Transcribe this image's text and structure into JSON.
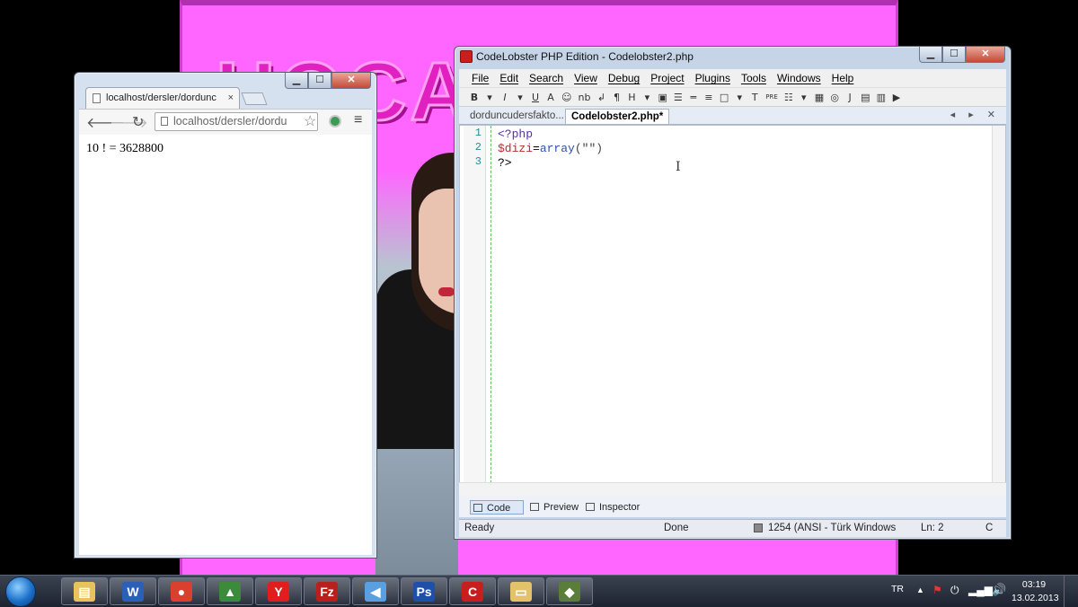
{
  "desktop": {
    "banner_text": "HOCA"
  },
  "browser": {
    "tab_title": "localhost/dersler/dordunc",
    "tab_close": "×",
    "address": "localhost/dersler/dordu",
    "page_output": "10 ! = 3628800"
  },
  "editor": {
    "window_title": "CodeLobster PHP Edition - Codelobster2.php",
    "menu": [
      "File",
      "Edit",
      "Search",
      "View",
      "Debug",
      "Project",
      "Plugins",
      "Tools",
      "Windows",
      "Help"
    ],
    "toolbar_glyphs": [
      "B",
      "▾",
      "I",
      "▾",
      "U",
      "A",
      "☺",
      "nb",
      "↲",
      "¶",
      "H",
      "▾",
      "▣",
      "☰",
      "═",
      "≡",
      "□",
      "▾",
      "T",
      "PRE",
      "☷",
      "▾",
      "▦",
      "◎",
      "J",
      "▤",
      "▥",
      "▶"
    ],
    "file_tabs": [
      "dorduncudersfakto...",
      "Codelobster2.php*"
    ],
    "tab_controls": "◂ ▸ ✕",
    "line_numbers": [
      "1",
      "2",
      "3"
    ],
    "code_lines": {
      "l1_tag": "<?php",
      "l2_var": "$dizi",
      "l2_eq": "=",
      "l2_fn": "array",
      "l2_args": "(\"\")",
      "l3_close": "?>"
    },
    "view_tabs": [
      "Code",
      "Preview",
      "Inspector"
    ],
    "status": {
      "left": "Ready",
      "mid": "Done",
      "encoding": "1254 (ANSI - Türk Windows",
      "line": "Ln: 2",
      "col": "C"
    }
  },
  "taskbar": {
    "apps": [
      {
        "name": "Windows Explorer",
        "glyph": "▤",
        "color": "#e8c25a"
      },
      {
        "name": "Word",
        "glyph": "W",
        "color": "#2b5fb8"
      },
      {
        "name": "Chrome",
        "glyph": "●",
        "color": "#d9412e"
      },
      {
        "name": "Image viewer",
        "glyph": "▲",
        "color": "#3b8b3b"
      },
      {
        "name": "Yandex",
        "glyph": "Y",
        "color": "#e11d1d"
      },
      {
        "name": "FileZilla",
        "glyph": "Fz",
        "color": "#b8201c"
      },
      {
        "name": "Media",
        "glyph": "◀",
        "color": "#5aa0e0"
      },
      {
        "name": "Photoshop",
        "glyph": "Ps",
        "color": "#1f4fa8"
      },
      {
        "name": "CodeLobster",
        "glyph": "C",
        "color": "#c81e1e"
      },
      {
        "name": "Folder",
        "glyph": "▭",
        "color": "#e2c36a"
      },
      {
        "name": "Tool",
        "glyph": "◆",
        "color": "#5b7d3a"
      }
    ],
    "lang": "TR",
    "time": "03:19",
    "date": "13.02.2013"
  }
}
